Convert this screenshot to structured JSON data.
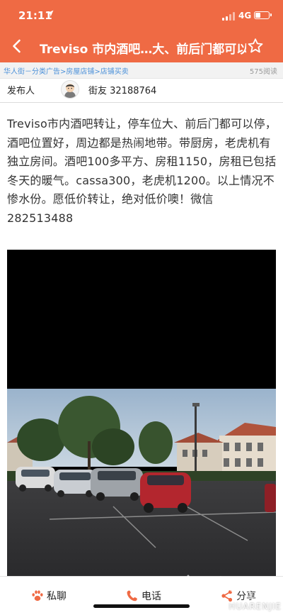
{
  "status_bar": {
    "time": "21:11",
    "network": "4G"
  },
  "header": {
    "title": "Treviso 市内酒吧…大、前后门都可以"
  },
  "breadcrumb": {
    "items": [
      "华人街－分类广告",
      "房屋店铺",
      "店铺买卖"
    ],
    "separator": ">",
    "views": "575阅读"
  },
  "publisher": {
    "label": "发布人",
    "name": "街友 32188764"
  },
  "post": {
    "body": "Treviso市内酒吧转让，停车位大、前后门都可以停，酒吧位置好，周边都是热闹地带。带厨房，老虎机有独立房间。酒吧100多平方、房租1150，房租已包括冬天的暖气。cassa300，老虎机1200。以上情况不惨水份。愿低价转让，绝对低价噢！微信282513488"
  },
  "bottom_bar": {
    "chat": "私聊",
    "call": "电话",
    "share": "分享"
  },
  "watermark": {
    "text": "HUARENJIE"
  },
  "colors": {
    "header": "#ef6a44",
    "link": "#4a90d9",
    "icon_accent": "#ef6a44"
  }
}
